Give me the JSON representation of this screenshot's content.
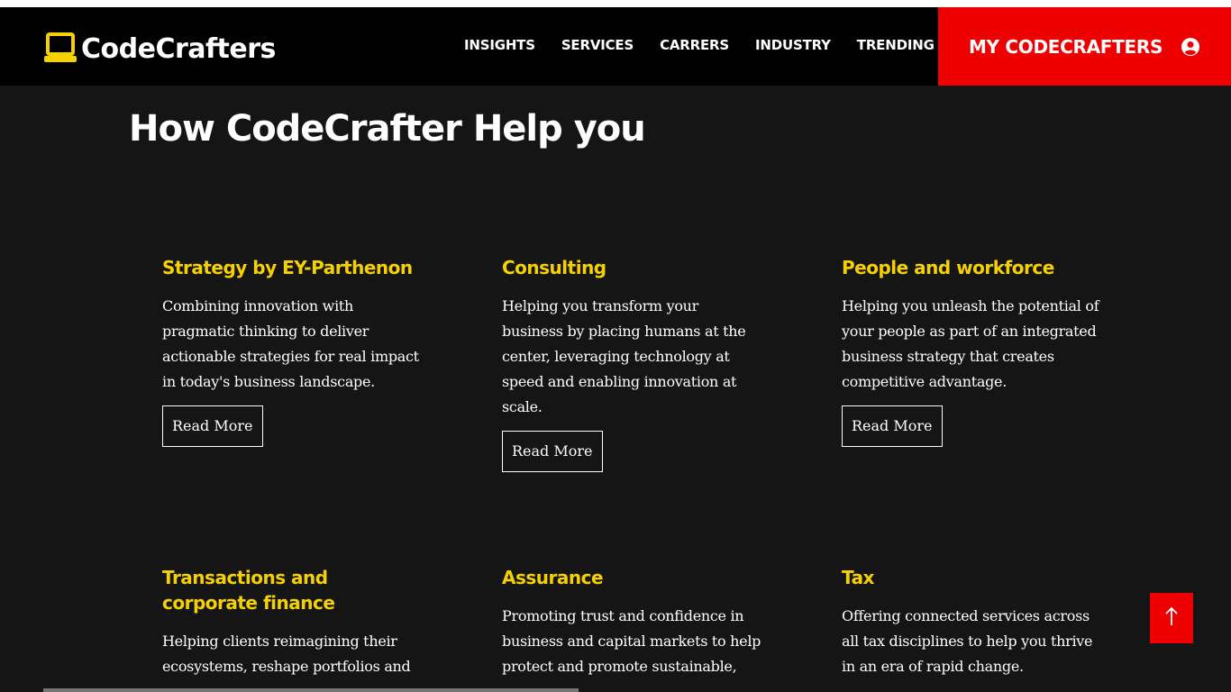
{
  "brand": {
    "name": "CodeCrafters",
    "accent": "#f5d100",
    "red": "#ee0000"
  },
  "nav": {
    "links": [
      {
        "label": "INSIGHTS"
      },
      {
        "label": "SERVICES"
      },
      {
        "label": "CARRERS"
      },
      {
        "label": "INDUSTRY"
      },
      {
        "label": "TRENDING"
      }
    ],
    "account_label": "MY CODECRAFTERS",
    "icons": {
      "logo": "laptop-icon",
      "dropdown": "chevron-down-icon",
      "account": "user-circle-icon"
    }
  },
  "main": {
    "title": "How CodeCrafter Help you",
    "cards": [
      {
        "title": "Strategy by EY-Parthenon",
        "desc": "Combining innovation with pragmatic thinking to deliver actionable strategies for real impact in today's business landscape.",
        "button": "Read More"
      },
      {
        "title": "Consulting",
        "desc": "Helping you transform your business by placing humans at the center, leveraging technology at speed and enabling innovation at scale.",
        "button": "Read More"
      },
      {
        "title": "People and workforce",
        "desc": "Helping you unleash the potential of your people as part of an integrated business strategy that creates competitive advantage.",
        "button": "Read More"
      },
      {
        "title": "Transactions and corporate finance",
        "desc": "Helping clients reimagining their ecosystems, reshape portfolios and"
      },
      {
        "title": "Assurance",
        "desc": "Promoting trust and confidence in business and capital markets to help protect and promote sustainable,"
      },
      {
        "title": "Tax",
        "desc": "Offering connected services across all tax disciplines to help you thrive in an era of rapid change."
      }
    ]
  },
  "scroll_top": {
    "icon": "arrow-up-icon"
  }
}
